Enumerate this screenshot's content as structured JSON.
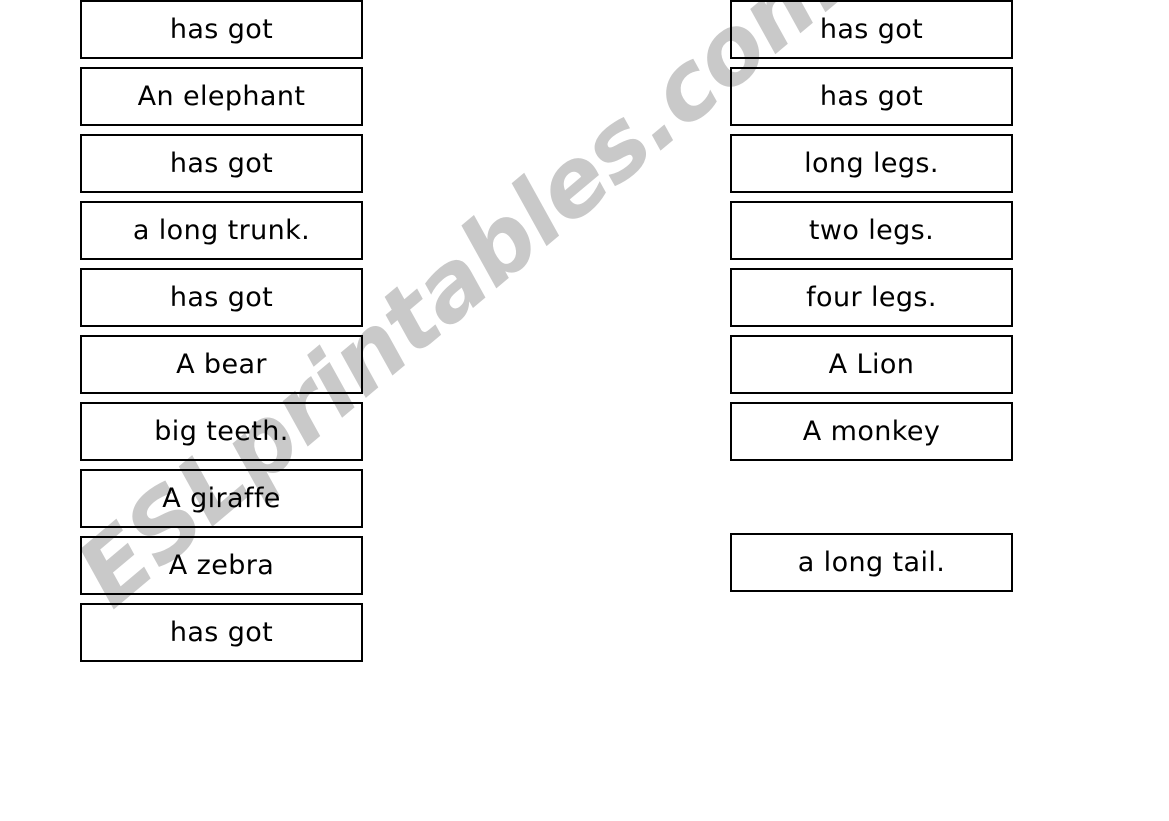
{
  "page": {
    "type": "worksheet",
    "background_color": "#ffffff",
    "border_color": "#000000",
    "text_color": "#000000"
  },
  "watermark": {
    "text": "ESLprintables.com",
    "color": "#c9c9c9",
    "rotation_deg": -40
  },
  "columns": [
    {
      "name": "left-column",
      "cards": [
        {
          "text": "has got"
        },
        {
          "text": "An elephant"
        },
        {
          "text": "has got"
        },
        {
          "text": "a long trunk."
        },
        {
          "text": "has got"
        },
        {
          "text": "A bear"
        },
        {
          "text": "big teeth."
        },
        {
          "text": "A giraffe"
        },
        {
          "text": "A zebra"
        },
        {
          "text": "has got"
        }
      ]
    },
    {
      "name": "right-column",
      "cards": [
        {
          "text": "has got",
          "gap_above": false
        },
        {
          "text": "has got",
          "gap_above": false
        },
        {
          "text": "long legs.",
          "gap_above": false
        },
        {
          "text": "two legs.",
          "gap_above": false
        },
        {
          "text": "four legs.",
          "gap_above": false
        },
        {
          "text": "A Lion",
          "gap_above": false
        },
        {
          "text": "A monkey",
          "gap_above": false
        },
        {
          "text": "a long tail.",
          "gap_above": true
        }
      ]
    }
  ]
}
